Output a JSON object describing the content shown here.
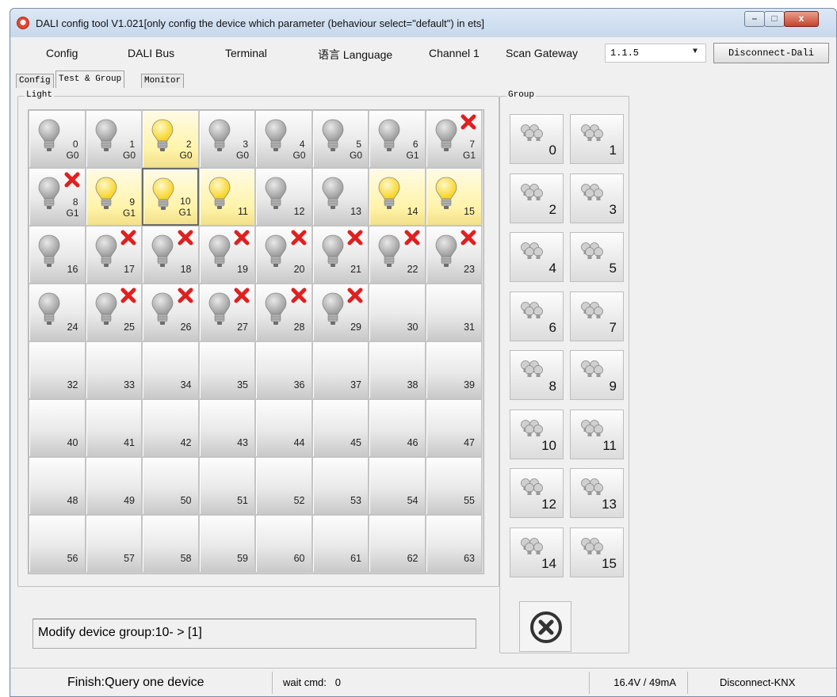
{
  "window": {
    "title": "DALI config tool V1.021[only config the device which parameter (behaviour select=\"default\") in ets]",
    "controls": {
      "minimize": "–",
      "maximize": "□",
      "close": "x"
    }
  },
  "menubar": {
    "items": [
      "Config",
      "DALI Bus",
      "Terminal",
      "语言 Language",
      "Channel 1",
      "Scan Gateway"
    ],
    "address_combo": {
      "value": "1.1.5"
    },
    "disconnect_dali": "Disconnect-Dali"
  },
  "tabs": [
    {
      "label": "Config",
      "active": false
    },
    {
      "label": "Test & Group",
      "active": true
    },
    {
      "label": "Monitor",
      "active": false
    }
  ],
  "light_panel": {
    "label": "Light",
    "devices": [
      {
        "n": "0",
        "g": "G0",
        "state": "off"
      },
      {
        "n": "1",
        "g": "G0",
        "state": "off"
      },
      {
        "n": "2",
        "g": "G0",
        "state": "on"
      },
      {
        "n": "3",
        "g": "G0",
        "state": "off"
      },
      {
        "n": "4",
        "g": "G0",
        "state": "off"
      },
      {
        "n": "5",
        "g": "G0",
        "state": "off"
      },
      {
        "n": "6",
        "g": "G1",
        "state": "off"
      },
      {
        "n": "7",
        "g": "G1",
        "state": "error"
      },
      {
        "n": "8",
        "g": "G1",
        "state": "error"
      },
      {
        "n": "9",
        "g": "G1",
        "state": "on"
      },
      {
        "n": "10",
        "g": "G1",
        "state": "on",
        "selected": true
      },
      {
        "n": "11",
        "g": "",
        "state": "on"
      },
      {
        "n": "12",
        "g": "",
        "state": "off"
      },
      {
        "n": "13",
        "g": "",
        "state": "off"
      },
      {
        "n": "14",
        "g": "",
        "state": "on"
      },
      {
        "n": "15",
        "g": "",
        "state": "on"
      },
      {
        "n": "16",
        "g": "",
        "state": "off"
      },
      {
        "n": "17",
        "g": "",
        "state": "error"
      },
      {
        "n": "18",
        "g": "",
        "state": "error"
      },
      {
        "n": "19",
        "g": "",
        "state": "error"
      },
      {
        "n": "20",
        "g": "",
        "state": "error"
      },
      {
        "n": "21",
        "g": "",
        "state": "error"
      },
      {
        "n": "22",
        "g": "",
        "state": "error"
      },
      {
        "n": "23",
        "g": "",
        "state": "error"
      },
      {
        "n": "24",
        "g": "",
        "state": "off"
      },
      {
        "n": "25",
        "g": "",
        "state": "error"
      },
      {
        "n": "26",
        "g": "",
        "state": "error"
      },
      {
        "n": "27",
        "g": "",
        "state": "error"
      },
      {
        "n": "28",
        "g": "",
        "state": "error"
      },
      {
        "n": "29",
        "g": "",
        "state": "error"
      },
      {
        "n": "30",
        "g": "",
        "state": "empty"
      },
      {
        "n": "31",
        "g": "",
        "state": "empty"
      },
      {
        "n": "32",
        "g": "",
        "state": "empty"
      },
      {
        "n": "33",
        "g": "",
        "state": "empty"
      },
      {
        "n": "34",
        "g": "",
        "state": "empty"
      },
      {
        "n": "35",
        "g": "",
        "state": "empty"
      },
      {
        "n": "36",
        "g": "",
        "state": "empty"
      },
      {
        "n": "37",
        "g": "",
        "state": "empty"
      },
      {
        "n": "38",
        "g": "",
        "state": "empty"
      },
      {
        "n": "39",
        "g": "",
        "state": "empty"
      },
      {
        "n": "40",
        "g": "",
        "state": "empty"
      },
      {
        "n": "41",
        "g": "",
        "state": "empty"
      },
      {
        "n": "42",
        "g": "",
        "state": "empty"
      },
      {
        "n": "43",
        "g": "",
        "state": "empty"
      },
      {
        "n": "44",
        "g": "",
        "state": "empty"
      },
      {
        "n": "45",
        "g": "",
        "state": "empty"
      },
      {
        "n": "46",
        "g": "",
        "state": "empty"
      },
      {
        "n": "47",
        "g": "",
        "state": "empty"
      },
      {
        "n": "48",
        "g": "",
        "state": "empty"
      },
      {
        "n": "49",
        "g": "",
        "state": "empty"
      },
      {
        "n": "50",
        "g": "",
        "state": "empty"
      },
      {
        "n": "51",
        "g": "",
        "state": "empty"
      },
      {
        "n": "52",
        "g": "",
        "state": "empty"
      },
      {
        "n": "53",
        "g": "",
        "state": "empty"
      },
      {
        "n": "54",
        "g": "",
        "state": "empty"
      },
      {
        "n": "55",
        "g": "",
        "state": "empty"
      },
      {
        "n": "56",
        "g": "",
        "state": "empty"
      },
      {
        "n": "57",
        "g": "",
        "state": "empty"
      },
      {
        "n": "58",
        "g": "",
        "state": "empty"
      },
      {
        "n": "59",
        "g": "",
        "state": "empty"
      },
      {
        "n": "60",
        "g": "",
        "state": "empty"
      },
      {
        "n": "61",
        "g": "",
        "state": "empty"
      },
      {
        "n": "62",
        "g": "",
        "state": "empty"
      },
      {
        "n": "63",
        "g": "",
        "state": "empty"
      }
    ]
  },
  "group_panel": {
    "label": "Group",
    "groups": [
      "0",
      "1",
      "2",
      "3",
      "4",
      "5",
      "6",
      "7",
      "8",
      "9",
      "10",
      "11",
      "12",
      "13",
      "14",
      "15"
    ],
    "cancel_icon": "circle-x-icon"
  },
  "message": "Modify device group:10- > [1]",
  "statusbar": {
    "finish": "Finish:Query one device",
    "wait_cmd_label": "wait cmd:",
    "wait_cmd_value": "0",
    "voltage": "16.4V / 49mA",
    "knx": "Disconnect-KNX"
  },
  "colors": {
    "bulb_on": "#f7d21b",
    "bulb_off": "#9a9a9a",
    "error_x": "#e02020",
    "cell_on_bg": "#fff3a8"
  },
  "icons": {
    "bulb": "light-bulb-icon",
    "error": "red-x-icon",
    "group": "bulb-cluster-icon",
    "app": "app-logo-icon"
  }
}
